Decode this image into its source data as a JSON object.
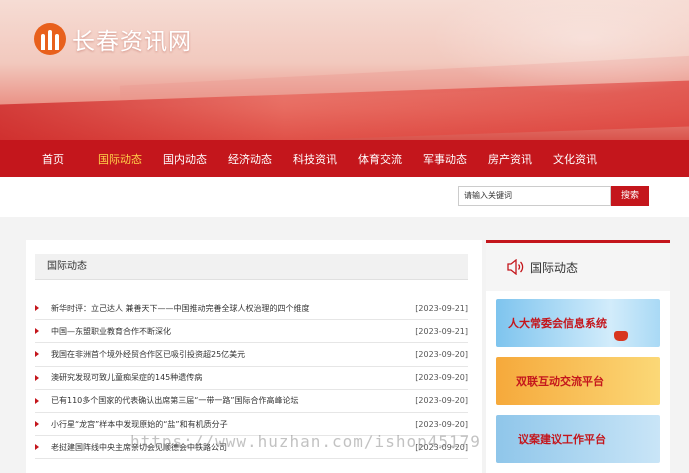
{
  "site": {
    "logo_text": "长春资讯网"
  },
  "nav": {
    "items": [
      "首页",
      "国际动态",
      "国内动态",
      "经济动态",
      "科技资讯",
      "体育交流",
      "军事动态",
      "房产资讯",
      "文化资讯"
    ],
    "active": "国际动态"
  },
  "search": {
    "placeholder": "请输入关键词",
    "button_label": "搜索"
  },
  "main": {
    "heading": "国际动态",
    "news": [
      {
        "title": "新华时评：立己达人 兼善天下——中国推动完善全球人权治理的四个维度",
        "date": "[2023-09-21]"
      },
      {
        "title": "中国—东盟职业教育合作不断深化",
        "date": "[2023-09-21]"
      },
      {
        "title": "我国在非洲首个境外经贸合作区已吸引投资超25亿美元",
        "date": "[2023-09-20]"
      },
      {
        "title": "澳研究发现可致儿童痴呆症的145种遗传病",
        "date": "[2023-09-20]"
      },
      {
        "title": "已有110多个国家的代表确认出席第三届“一带一路”国际合作高峰论坛",
        "date": "[2023-09-20]"
      },
      {
        "title": "小行星“龙宫”样本中发现原始的“盐”和有机质分子",
        "date": "[2023-09-20]"
      },
      {
        "title": "老挝建国阵线中央主席亲切会见顺德会中铁路公司",
        "date": "[2023-09-20]"
      }
    ]
  },
  "sidebar": {
    "heading": "国际动态",
    "banners": [
      "人大常委会信息系统",
      "双联互动交流平台",
      "议案建议工作平台"
    ]
  },
  "watermark": "https://www.huzhan.com/ishop45179",
  "colors": {
    "brand_red": "#c4161c",
    "active_nav": "#ffd24a"
  }
}
